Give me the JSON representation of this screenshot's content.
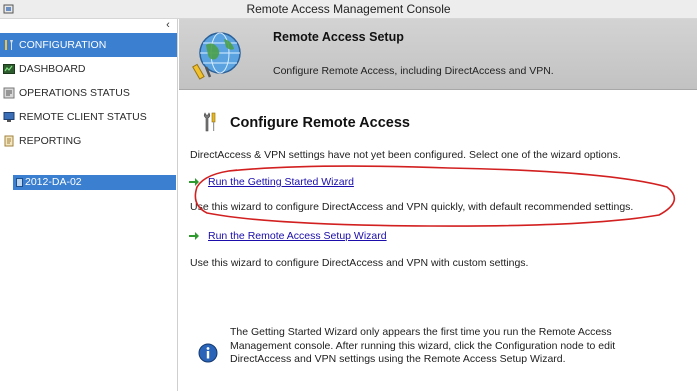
{
  "window": {
    "title": "Remote Access Management Console"
  },
  "sidebar": {
    "collapse_glyph": "‹",
    "items": [
      {
        "label": "CONFIGURATION",
        "icon": "wrench-screwdriver-icon",
        "active": true
      },
      {
        "label": "DASHBOARD",
        "icon": "dashboard-icon",
        "active": false
      },
      {
        "label": "OPERATIONS STATUS",
        "icon": "operations-icon",
        "active": false
      },
      {
        "label": "REMOTE CLIENT STATUS",
        "icon": "monitor-icon",
        "active": false
      },
      {
        "label": "REPORTING",
        "icon": "report-icon",
        "active": false
      }
    ],
    "server": {
      "label": "2012-DA-02",
      "icon": "server-icon"
    }
  },
  "header": {
    "title": "Remote Access Setup",
    "subtitle": "Configure Remote Access, including DirectAccess and VPN.",
    "icon": "globe-network-icon"
  },
  "content": {
    "title": "Configure Remote Access",
    "intro": "DirectAccess & VPN settings have not yet been configured. Select one of the wizard options.",
    "wizards": [
      {
        "link": "Run the Getting Started Wizard",
        "description": "Use this wizard to configure DirectAccess and VPN quickly, with default recommended settings."
      },
      {
        "link": "Run the Remote Access Setup Wizard",
        "description": "Use this wizard to configure DirectAccess and VPN with custom settings."
      }
    ]
  },
  "info": {
    "icon": "info-icon",
    "text": "The Getting Started Wizard only appears the first time you run the Remote Access Management console. After running this wizard, click the Configuration node to edit DirectAccess and VPN settings using the Remote Access Setup Wizard."
  },
  "colors": {
    "selection": "#3a7fd0",
    "link": "#1a0dab",
    "annotation": "#d22020",
    "arrow": "#2f9a2f"
  }
}
